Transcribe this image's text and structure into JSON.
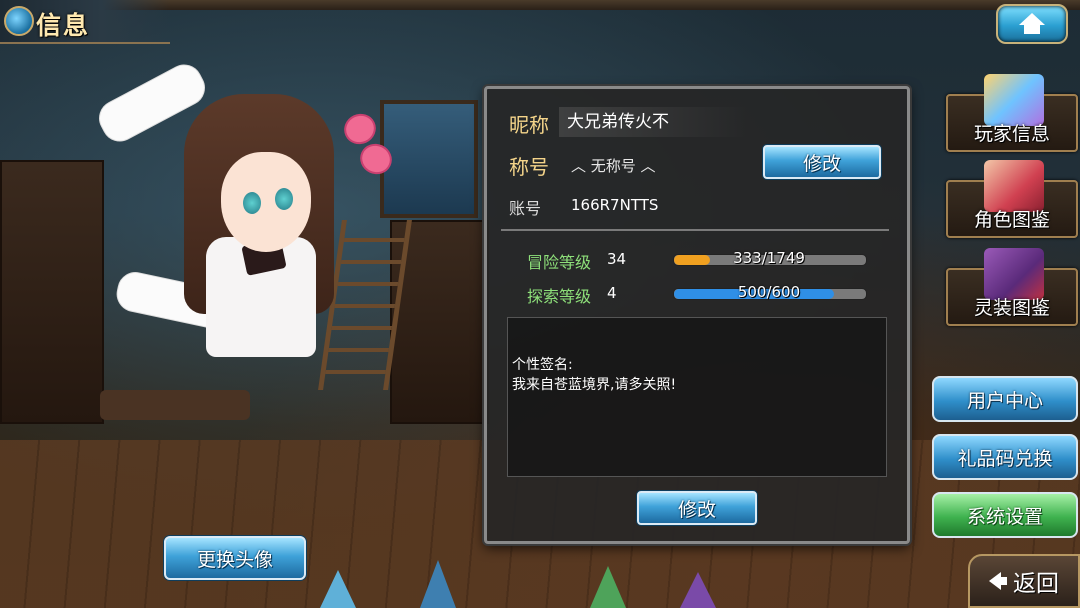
{
  "header": {
    "title": "信息"
  },
  "character": {
    "name_hint": "avatar-character"
  },
  "profile": {
    "nickname_label": "昵称",
    "nickname_value": "大兄弟传火不",
    "title_label": "称号",
    "title_value": "︿ 无称号 ︿",
    "title_edit_label": "修改",
    "account_label": "账号",
    "account_value": "166R7NTTS"
  },
  "stats": {
    "adventure_label": "冒险等级",
    "adventure_level": "34",
    "adventure_exp_text": "333/1749",
    "adventure_progress": 0.19,
    "adventure_color": "#f0a020",
    "explore_label": "探索等级",
    "explore_level": "4",
    "explore_exp_text": "500/600",
    "explore_progress": 0.833,
    "explore_color": "#2f8fe6"
  },
  "signature": {
    "title": "个性签名:",
    "text": "我来自苍蓝境界,请多关照!",
    "edit_label": "修改"
  },
  "right_menu": {
    "player_info": "玩家信息",
    "character_gallery": "角色图鉴",
    "equipment_gallery": "灵装图鉴"
  },
  "side_buttons": {
    "user_center": "用户中心",
    "gift_code": "礼品码兑换",
    "system_settings": "系统设置"
  },
  "bottom": {
    "change_avatar": "更换头像",
    "back": "返回"
  }
}
